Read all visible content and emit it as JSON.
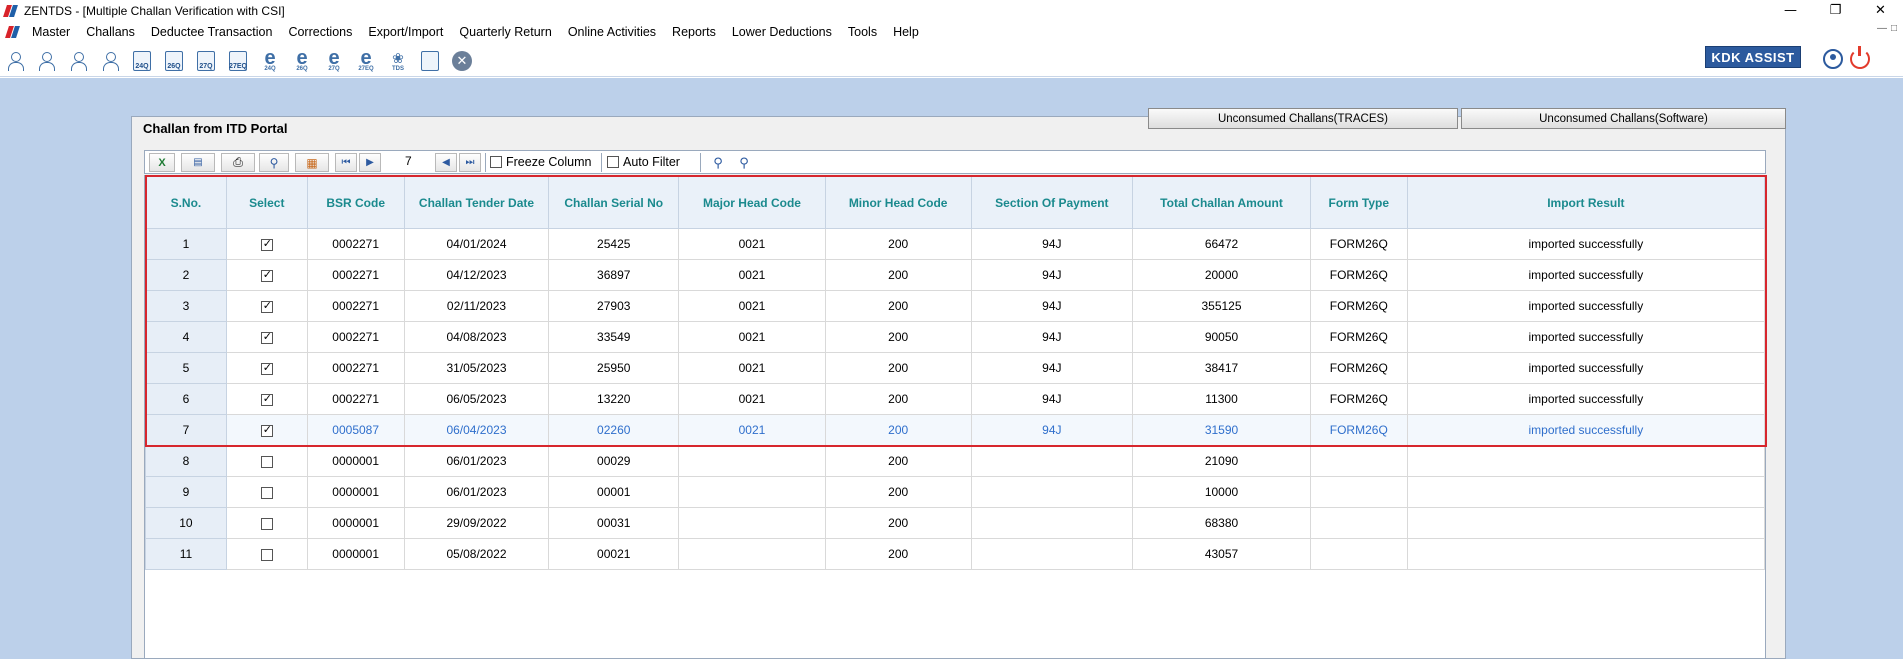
{
  "window": {
    "title": "ZENTDS - [Multiple Challan Verification with CSI]",
    "controls": [
      "—",
      "❐",
      "✕"
    ]
  },
  "menu": [
    "Master",
    "Challans",
    "Deductee Transaction",
    "Corrections",
    "Export/Import",
    "Quarterly Return",
    "Online Activities",
    "Reports",
    "Lower Deductions",
    "Tools",
    "Help"
  ],
  "toolbar": {
    "icons": [
      "deductor-icon",
      "deductees-icon",
      "employee-icon",
      "employee-salary-icon",
      "form-24q-icon",
      "form-26q-icon",
      "form-27q-icon",
      "form-27eq-icon",
      "e-24q-icon",
      "e-26q-icon",
      "e-27q-icon",
      "e-27eq-icon",
      "tds-icon",
      "report-icon",
      "close-icon"
    ],
    "e_labels": [
      "24Q",
      "26Q",
      "27Q",
      "27EQ"
    ],
    "doc_labels": [
      "24Q",
      "26Q",
      "27Q",
      "27EQ"
    ],
    "tds_label": "TDS",
    "kdk_label": "KDK ASSIST"
  },
  "panel": {
    "title": "Challan from ITD Portal",
    "btn_traces": "Unconsumed Challans(TRACES)",
    "btn_software": "Unconsumed Challans(Software)"
  },
  "gridbar": {
    "record_count": "7",
    "freeze_label": "Freeze Column",
    "autofilter_label": "Auto Filter"
  },
  "table": {
    "columns": [
      "S.No.",
      "Select",
      "BSR Code",
      "Challan Tender Date",
      "Challan Serial No",
      "Major Head Code",
      "Minor Head Code",
      "Section Of Payment",
      "Total Challan Amount",
      "Form Type",
      "Import Result"
    ],
    "rows": [
      {
        "sno": "1",
        "checked": true,
        "bsr": "0002271",
        "date": "04/01/2024",
        "serial": "25425",
        "major": "0021",
        "minor": "200",
        "section": "94J",
        "amount": "66472",
        "form": "FORM26Q",
        "result": "imported successfully"
      },
      {
        "sno": "2",
        "checked": true,
        "bsr": "0002271",
        "date": "04/12/2023",
        "serial": "36897",
        "major": "0021",
        "minor": "200",
        "section": "94J",
        "amount": "20000",
        "form": "FORM26Q",
        "result": "imported successfully"
      },
      {
        "sno": "3",
        "checked": true,
        "bsr": "0002271",
        "date": "02/11/2023",
        "serial": "27903",
        "major": "0021",
        "minor": "200",
        "section": "94J",
        "amount": "355125",
        "form": "FORM26Q",
        "result": "imported successfully"
      },
      {
        "sno": "4",
        "checked": true,
        "bsr": "0002271",
        "date": "04/08/2023",
        "serial": "33549",
        "major": "0021",
        "minor": "200",
        "section": "94J",
        "amount": "90050",
        "form": "FORM26Q",
        "result": "imported successfully"
      },
      {
        "sno": "5",
        "checked": true,
        "bsr": "0002271",
        "date": "31/05/2023",
        "serial": "25950",
        "major": "0021",
        "minor": "200",
        "section": "94J",
        "amount": "38417",
        "form": "FORM26Q",
        "result": "imported successfully"
      },
      {
        "sno": "6",
        "checked": true,
        "bsr": "0002271",
        "date": "06/05/2023",
        "serial": "13220",
        "major": "0021",
        "minor": "200",
        "section": "94J",
        "amount": "11300",
        "form": "FORM26Q",
        "result": "imported successfully"
      },
      {
        "sno": "7",
        "checked": true,
        "bsr": "0005087",
        "date": "06/04/2023",
        "serial": "02260",
        "major": "0021",
        "minor": "200",
        "section": "94J",
        "amount": "31590",
        "form": "FORM26Q",
        "result": "imported successfully",
        "highlight": true
      },
      {
        "sno": "8",
        "checked": false,
        "bsr": "0000001",
        "date": "06/01/2023",
        "serial": "00029",
        "major": "",
        "minor": "200",
        "section": "",
        "amount": "21090",
        "form": "",
        "result": ""
      },
      {
        "sno": "9",
        "checked": false,
        "bsr": "0000001",
        "date": "06/01/2023",
        "serial": "00001",
        "major": "",
        "minor": "200",
        "section": "",
        "amount": "10000",
        "form": "",
        "result": ""
      },
      {
        "sno": "10",
        "checked": false,
        "bsr": "0000001",
        "date": "29/09/2022",
        "serial": "00031",
        "major": "",
        "minor": "200",
        "section": "",
        "amount": "68380",
        "form": "",
        "result": ""
      },
      {
        "sno": "11",
        "checked": false,
        "bsr": "0000001",
        "date": "05/08/2022",
        "serial": "00021",
        "major": "",
        "minor": "200",
        "section": "",
        "amount": "43057",
        "form": "",
        "result": ""
      }
    ]
  },
  "colors": {
    "header_text": "#1b8a8e",
    "highlight_text": "#2f6fcc",
    "annotation": "#d7262d",
    "desktop": "#bcd0ea"
  }
}
